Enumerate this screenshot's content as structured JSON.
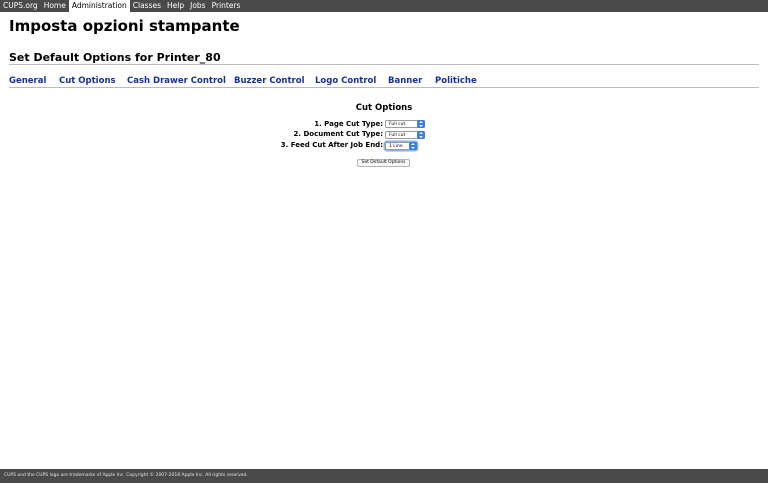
{
  "nav": {
    "items": [
      {
        "label": "CUPS.org"
      },
      {
        "label": "Home"
      },
      {
        "label": "Administration",
        "active": true
      },
      {
        "label": "Classes"
      },
      {
        "label": "Help"
      },
      {
        "label": "Jobs"
      },
      {
        "label": "Printers"
      }
    ]
  },
  "page": {
    "title": "Imposta opzioni stampante",
    "subtitle": "Set Default Options for Printer_80"
  },
  "tabs": [
    {
      "label": "General"
    },
    {
      "label": "Cut Options"
    },
    {
      "label": "Cash Drawer Control"
    },
    {
      "label": "Buzzer Control"
    },
    {
      "label": "Logo Control"
    },
    {
      "label": "Banner"
    },
    {
      "label": "Politiche"
    }
  ],
  "form": {
    "section_title": "Cut Options",
    "options": [
      {
        "label": "1. Page Cut Type:",
        "value": "Full cut"
      },
      {
        "label": "2. Document Cut Type:",
        "value": "Full cut"
      },
      {
        "label": "3. Feed Cut After Job End:",
        "value": "1 Line"
      }
    ],
    "submit_label": "Set Default Options"
  },
  "footer": {
    "text": "CUPS and the CUPS logo are trademarks of Apple Inc. Copyright © 2007-2018 Apple Inc. All rights reserved."
  },
  "colors": {
    "nav_bg": "#4a4a4a",
    "link": "#1a2e9c",
    "select_stepper": "#3a7ee0"
  }
}
